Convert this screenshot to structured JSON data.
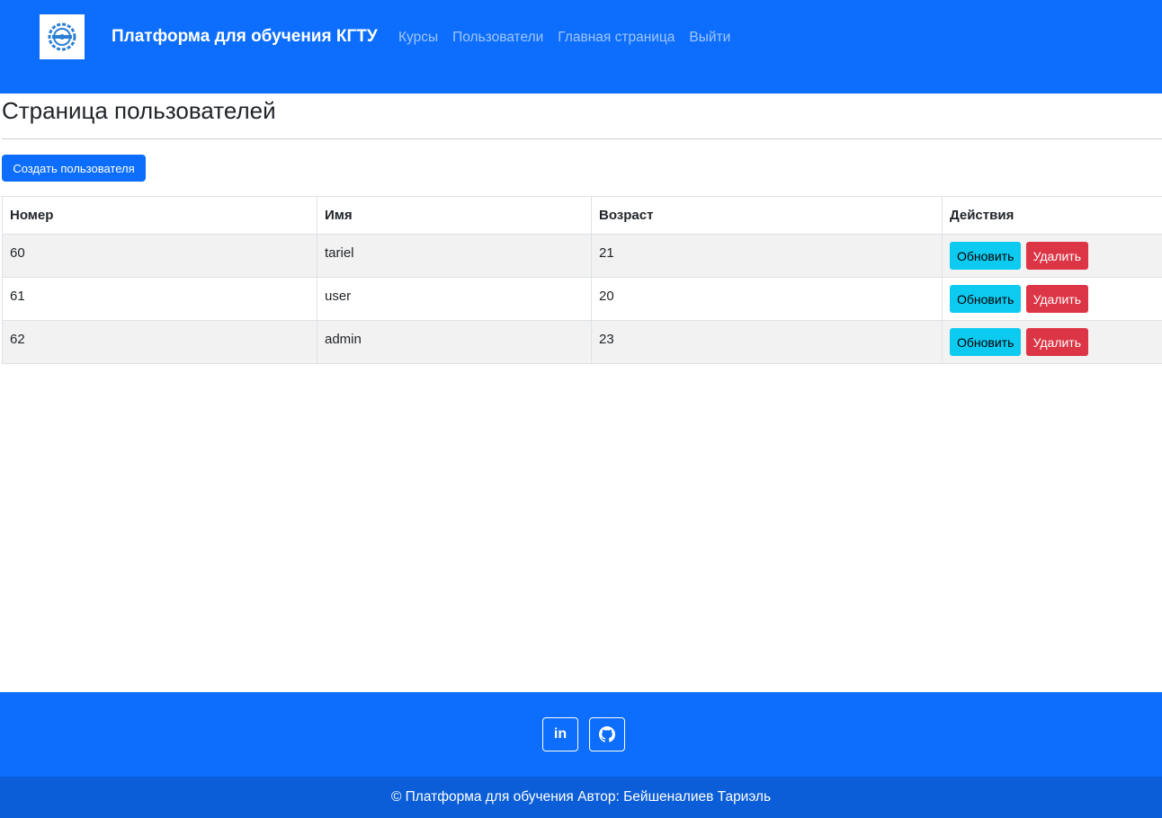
{
  "colors": {
    "primary": "#0d6efd",
    "footer_bottom": "#0b5ed7",
    "info": "#0dcaf0",
    "danger": "#dc3545"
  },
  "navbar": {
    "logo_icon": "gear-logo-icon",
    "brand": "Платформа для обучения КГТУ",
    "links": [
      "Курсы",
      "Пользователи",
      "Главная страница",
      "Выйти"
    ]
  },
  "page": {
    "title": "Страница пользователей",
    "create_button": "Создать пользователя"
  },
  "table": {
    "headers": [
      "Номер",
      "Имя",
      "Возраст",
      "Действия"
    ],
    "rows": [
      {
        "id": "60",
        "name": "tariel",
        "age": "21"
      },
      {
        "id": "61",
        "name": "user",
        "age": "20"
      },
      {
        "id": "62",
        "name": "admin",
        "age": "23"
      }
    ],
    "update_label": "Обновить",
    "delete_label": "Удалить"
  },
  "footer": {
    "social": [
      {
        "icon": "linkedin-icon",
        "glyph": "in"
      },
      {
        "icon": "github-icon"
      }
    ],
    "copyright": "© Платформа для обучения Автор: Бейшеналиев Тариэль"
  }
}
